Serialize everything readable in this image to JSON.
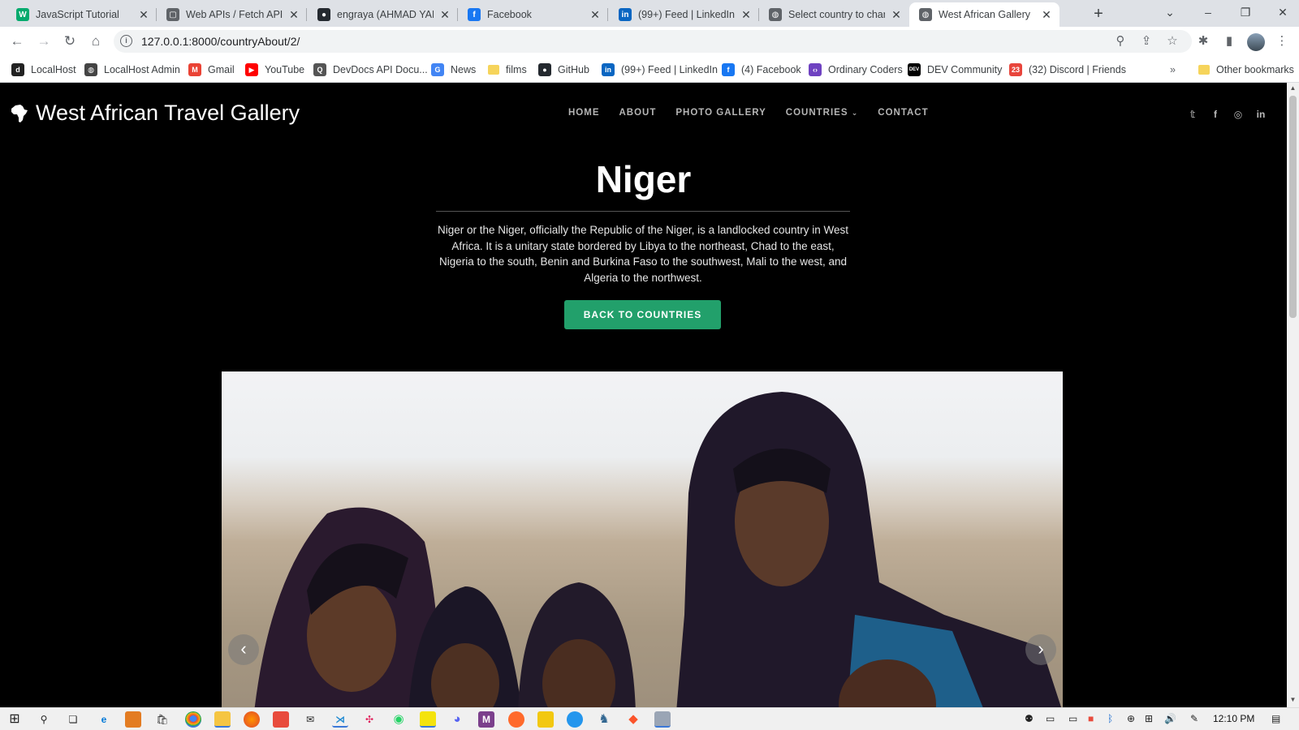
{
  "browser": {
    "tabs": [
      {
        "title": "JavaScript Tutorial",
        "icon": "w3schools-icon",
        "color": "#04aa6d",
        "glyph": "W"
      },
      {
        "title": "Web APIs / Fetch API: U",
        "icon": "web-page-icon",
        "color": "#5f6368",
        "glyph": "▢"
      },
      {
        "title": "engraya (AHMAD YAKU",
        "icon": "github-icon",
        "color": "#24292f",
        "glyph": "●"
      },
      {
        "title": "Facebook",
        "icon": "facebook-icon",
        "color": "#1877f2",
        "glyph": "f"
      },
      {
        "title": "(99+) Feed | LinkedIn",
        "icon": "linkedin-icon",
        "color": "#0a66c2",
        "glyph": "in"
      },
      {
        "title": "Select country to chang",
        "icon": "globe-icon",
        "color": "#5f6368",
        "glyph": "◍"
      },
      {
        "title": "West African Gallery",
        "icon": "globe-icon",
        "color": "#5f6368",
        "glyph": "◍"
      }
    ],
    "active_tab": 6,
    "url": "127.0.0.1:8000/countryAbout/2/",
    "bookmarks": [
      {
        "label": "LocalHost",
        "icon": "django-icon",
        "color": "#222",
        "glyph": "d"
      },
      {
        "label": "LocalHost Admin",
        "icon": "globe-icon",
        "color": "#444",
        "glyph": "◍"
      },
      {
        "label": "Gmail",
        "icon": "gmail-icon",
        "color": "#ea4335",
        "glyph": "M"
      },
      {
        "label": "YouTube",
        "icon": "youtube-icon",
        "color": "#ff0000",
        "glyph": "▶"
      },
      {
        "label": "DevDocs API Docu...",
        "icon": "devdocs-icon",
        "color": "#555",
        "glyph": "Q"
      },
      {
        "label": "News",
        "icon": "google-news-icon",
        "color": "#4285f4",
        "glyph": "G"
      },
      {
        "label": "films",
        "icon": "folder-icon",
        "color": "#f6d45b",
        "glyph": ""
      },
      {
        "label": "GitHub",
        "icon": "github-icon",
        "color": "#24292f",
        "glyph": "●"
      },
      {
        "label": "(99+) Feed | LinkedIn",
        "icon": "linkedin-icon",
        "color": "#0a66c2",
        "glyph": "in"
      },
      {
        "label": "(4) Facebook",
        "icon": "facebook-icon",
        "color": "#1877f2",
        "glyph": "f"
      },
      {
        "label": "Ordinary Coders",
        "icon": "code-icon",
        "color": "#6f42c1",
        "glyph": "‹›"
      },
      {
        "label": "DEV Community",
        "icon": "dev-icon",
        "color": "#000",
        "glyph": "DEV"
      },
      {
        "label": "(32) Discord | Friends",
        "icon": "discord-icon",
        "color": "#e8453c",
        "glyph": "23"
      }
    ],
    "other_bookmarks": "Other bookmarks",
    "more_bookmarks": "»"
  },
  "site": {
    "brand": "West African Travel Gallery",
    "nav": [
      {
        "label": "HOME",
        "active": true
      },
      {
        "label": "ABOUT",
        "active": false
      },
      {
        "label": "PHOTO GALLERY",
        "active": false
      },
      {
        "label": "COUNTRIES",
        "active": false,
        "dropdown": true
      },
      {
        "label": "CONTACT",
        "active": false
      }
    ],
    "social": [
      "twitter-icon",
      "facebook-icon",
      "instagram-icon",
      "linkedin-icon"
    ]
  },
  "country": {
    "name": "Niger",
    "description": "Niger or the Niger, officially the Republic of the Niger, is a landlocked country in West Africa. It is a unitary state bordered by Libya to the northeast, Chad to the east, Nigeria to the south, Benin and Burkina Faso to the southwest, Mali to the west, and Algeria to the northwest.",
    "back_button": "BACK TO COUNTRIES",
    "accent": "#22a06b"
  },
  "carousel": {
    "prev": "‹",
    "next": "›"
  },
  "taskbar": {
    "time": "12:10 PM"
  }
}
